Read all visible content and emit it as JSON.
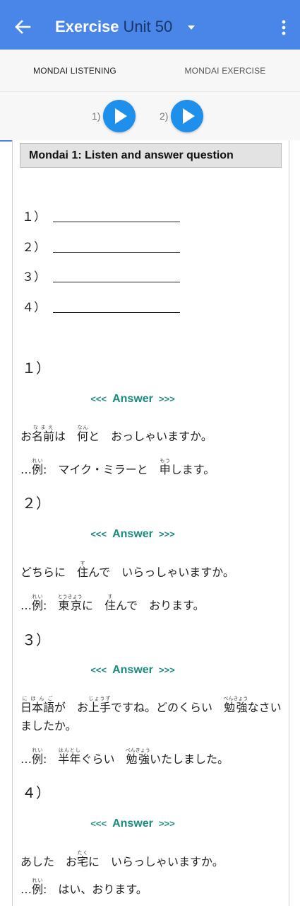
{
  "app_bar": {
    "title": "Exercise",
    "subtitle": "Unit 50",
    "back_icon": "arrow-left-icon",
    "dropdown_icon": "caret-down-icon",
    "more_icon": "more-vert-icon",
    "color": "#4a86e8"
  },
  "tabs": [
    {
      "label": "MONDAI LISTENING",
      "active": true
    },
    {
      "label": "MONDAI EXERCISE",
      "active": false
    }
  ],
  "players": [
    {
      "label": "1)",
      "icon": "play-icon"
    },
    {
      "label": "2)",
      "icon": "play-icon"
    }
  ],
  "section_title": "Mondai 1: Listen and answer question",
  "blanks": [
    "１）",
    "２）",
    "３）",
    "４）"
  ],
  "answer_link": {
    "left": "<<<",
    "word": "Answer",
    "right": ">>>",
    "color": "#1a8c80"
  },
  "questions": [
    {
      "number": "１）",
      "question": "お名前は　何と　おっしゃいますか。",
      "example": "…例:　マイク・ミラーと　申します。"
    },
    {
      "number": "２）",
      "question": "どちらに　住んで　いらっしゃいますか。",
      "example": "…例:　東京に　住んで　おります。"
    },
    {
      "number": "３）",
      "question": "日本語が　お上手ですね。どのくらい　勉強なさいましたか。",
      "example": "…例:　半年ぐらい　勉強いたしました。"
    },
    {
      "number": "４）",
      "question": "あした　お宅に　いらっしゃいますか。",
      "example": "…例:　はい、おります。"
    }
  ],
  "furigana": {
    "q1": {
      "namae": "なまえ",
      "nan": "なん",
      "rei": "れい",
      "mou": "もう"
    },
    "q2": {
      "su": "す",
      "rei": "れい",
      "toukyou": "とうきょう",
      "su2": "す"
    },
    "q3": {
      "nihongo": "にほんご",
      "jouzu": "じょうず",
      "benkyou": "べんきょう",
      "rei": "れい",
      "hantoshi": "はんとし",
      "benkyou2": "べんきょう"
    },
    "q4": {
      "taku": "たく",
      "rei": "れい"
    }
  }
}
